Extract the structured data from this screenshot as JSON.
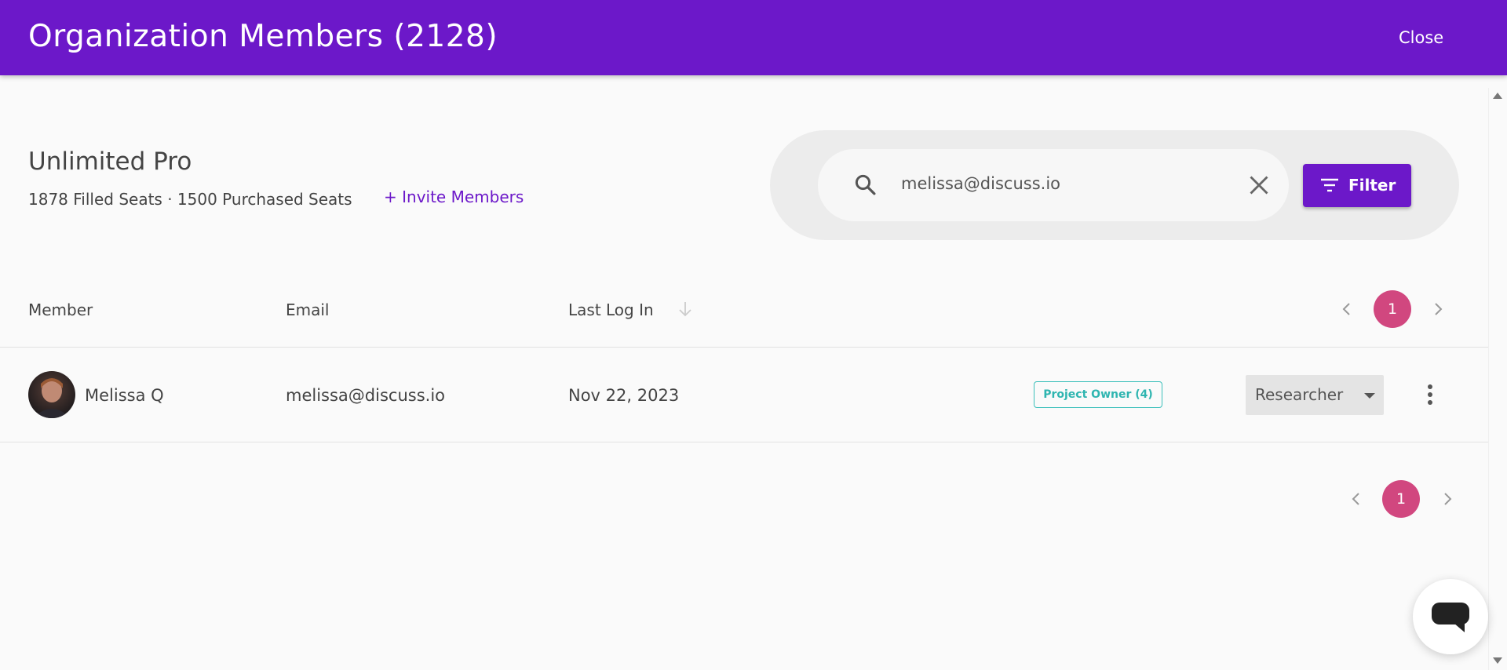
{
  "header": {
    "title": "Organization Members (2128)",
    "close_label": "Close"
  },
  "plan": {
    "name": "Unlimited Pro",
    "seats_text": "1878 Filled Seats · 1500 Purchased Seats",
    "invite_label": "+ Invite Members"
  },
  "search": {
    "value": "melissa@discuss.io",
    "search_icon": "search-icon",
    "clear_icon": "close-icon"
  },
  "filter": {
    "label": "Filter",
    "icon": "filter-list-icon"
  },
  "table": {
    "columns": [
      "Member",
      "Email",
      "Last Log In"
    ],
    "sort_icon": "arrow-down-icon",
    "rows": [
      {
        "member": "Melissa Q",
        "email": "melissa@discuss.io",
        "last_login": "Nov 22, 2023",
        "badge": "Project Owner (4)",
        "role": "Researcher"
      }
    ]
  },
  "pagination": {
    "current_page": "1",
    "prev_icon": "chevron-left-icon",
    "next_icon": "chevron-right-icon"
  },
  "colors": {
    "brand_purple": "#6c18c9",
    "page_pink": "#d1477f",
    "badge_teal": "#3cc0bb"
  }
}
